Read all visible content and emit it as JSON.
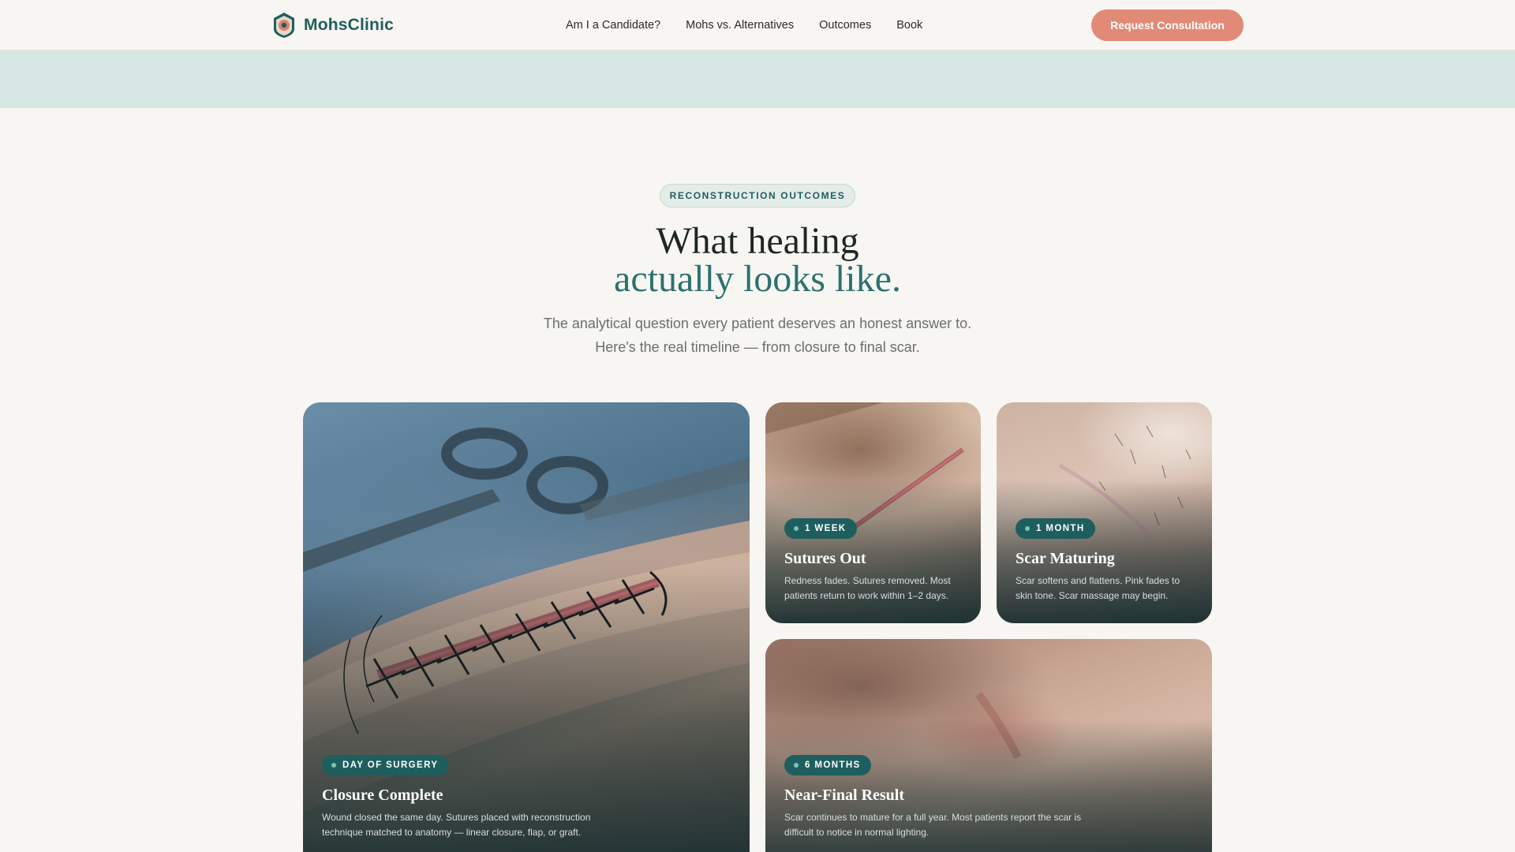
{
  "nav": {
    "brand": "MohsClinic",
    "links": [
      "Am I a Candidate?",
      "Mohs vs. Alternatives",
      "Outcomes",
      "Book"
    ],
    "cta": "Request Consultation"
  },
  "header": {
    "eyebrow": "RECONSTRUCTION OUTCOMES",
    "title_line1": "What healing",
    "title_line2": "actually looks like.",
    "subtitle_line1": "The analytical question every patient deserves an honest answer to.",
    "subtitle_line2": "Here's the real timeline — from closure to final scar."
  },
  "cards": [
    {
      "badge": "DAY OF SURGERY",
      "title": "Closure Complete",
      "text_line1": "Wound closed the same day. Sutures placed with reconstruction",
      "text_line2": "technique matched to anatomy — linear closure, flap, or graft."
    },
    {
      "badge": "1 WEEK",
      "title": "Sutures Out",
      "text_line1": "Redness fades. Sutures removed. Most",
      "text_line2": "patients return to work within 1–2 days."
    },
    {
      "badge": "1 MONTH",
      "title": "Scar Maturing",
      "text_line1": "Scar softens and flattens. Pink fades to",
      "text_line2": "skin tone. Scar massage may begin."
    },
    {
      "badge": "6 MONTHS",
      "title": "Near-Final Result",
      "text_line1": "Scar continues to mature for a full year. Most patients report the scar is",
      "text_line2": "difficult to notice in normal lighting."
    }
  ],
  "colors": {
    "brand": "#1f5e5e",
    "accent": "#e18a78",
    "band": "#d7e7e3",
    "background": "#f8f6f2"
  },
  "icons": [
    "clinic-shield-logo-icon",
    "badge-dot-icon"
  ]
}
